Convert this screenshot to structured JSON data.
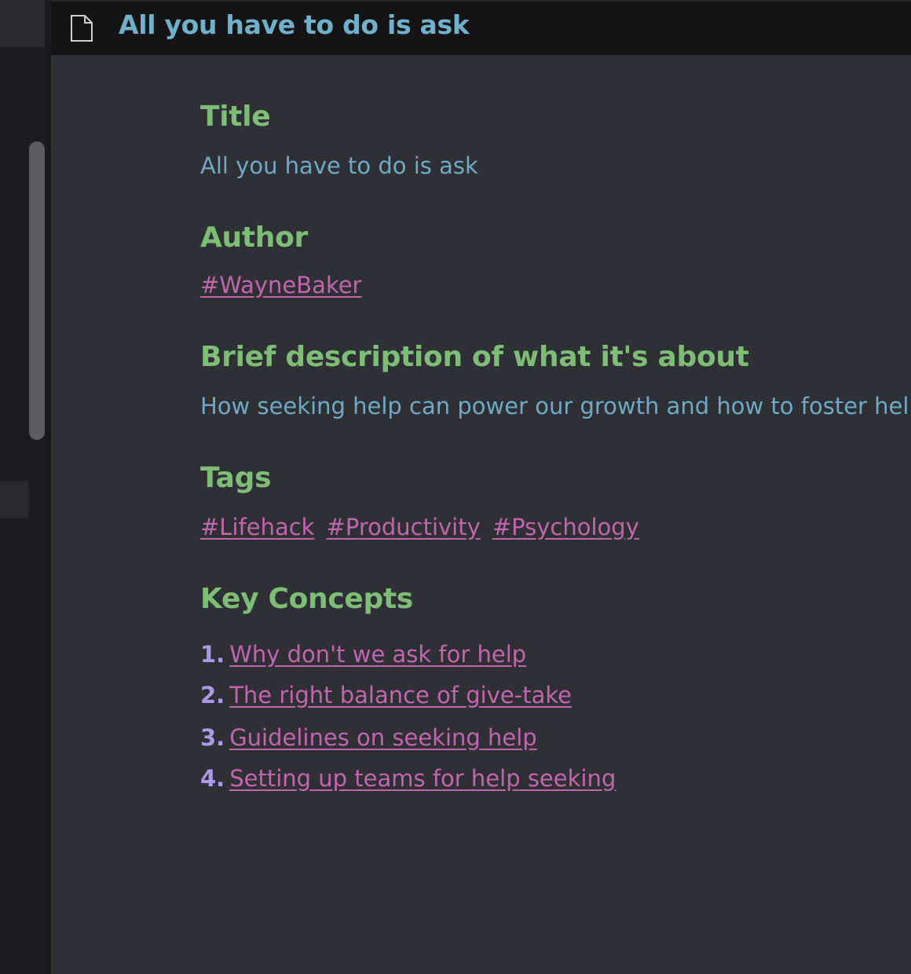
{
  "titlebar": {
    "icon": "document-icon",
    "title": "All you have to do is ask"
  },
  "sections": {
    "title": {
      "heading": "Title",
      "value": "All you have to do is ask"
    },
    "author": {
      "heading": "Author",
      "tag": "#WayneBaker"
    },
    "description": {
      "heading": "Brief description of what it's about",
      "value": "How seeking help can power our growth and how to foster help-"
    },
    "tags": {
      "heading": "Tags",
      "items": [
        "#Lifehack",
        "#Productivity",
        "#Psychology"
      ]
    },
    "key_concepts": {
      "heading": "Key Concepts",
      "items": [
        {
          "num": "1.",
          "label": "Why don't we ask for help"
        },
        {
          "num": "2.",
          "label": "The right balance of give-take"
        },
        {
          "num": "3.",
          "label": "Guidelines on seeking help"
        },
        {
          "num": "4.",
          "label": "Setting up teams for help seeking"
        }
      ]
    }
  },
  "colors": {
    "heading": "#7dbd76",
    "text": "#6fa9c3",
    "link": "#c165ad",
    "number": "#ab98e8",
    "background": "#2f3036"
  }
}
